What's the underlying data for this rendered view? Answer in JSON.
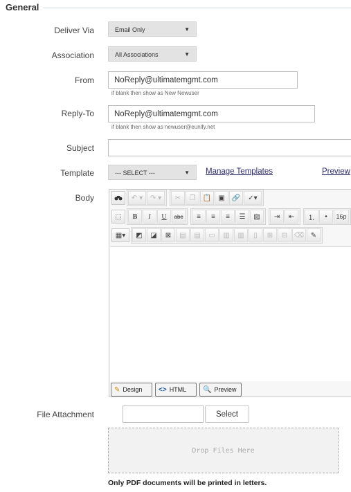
{
  "section": {
    "title": "General"
  },
  "fields": {
    "deliver_via": {
      "label": "Deliver Via",
      "value": "Email Only"
    },
    "association": {
      "label": "Association",
      "value": "All Associations"
    },
    "from": {
      "label": "From",
      "value": "NoReply@ultimatemgmt.com",
      "hint": "if blank then show as New Newuser"
    },
    "reply_to": {
      "label": "Reply-To",
      "value": "NoReply@ultimatemgmt.com",
      "hint": "if blank then show as newuser@eunify.net"
    },
    "subject": {
      "label": "Subject",
      "value": ""
    },
    "template": {
      "label": "Template",
      "value": "--- SELECT ---",
      "manage_link": "Manage Templates",
      "preview_link": "Preview"
    },
    "body": {
      "label": "Body"
    },
    "file_attachment": {
      "label": "File Attachment",
      "select_button": "Select",
      "dropzone": "Drop Files Here"
    }
  },
  "editor": {
    "font_size": "16p",
    "modes": {
      "design": "Design",
      "html": "HTML",
      "preview": "Preview"
    }
  },
  "note": "Only PDF documents will be printed in letters."
}
